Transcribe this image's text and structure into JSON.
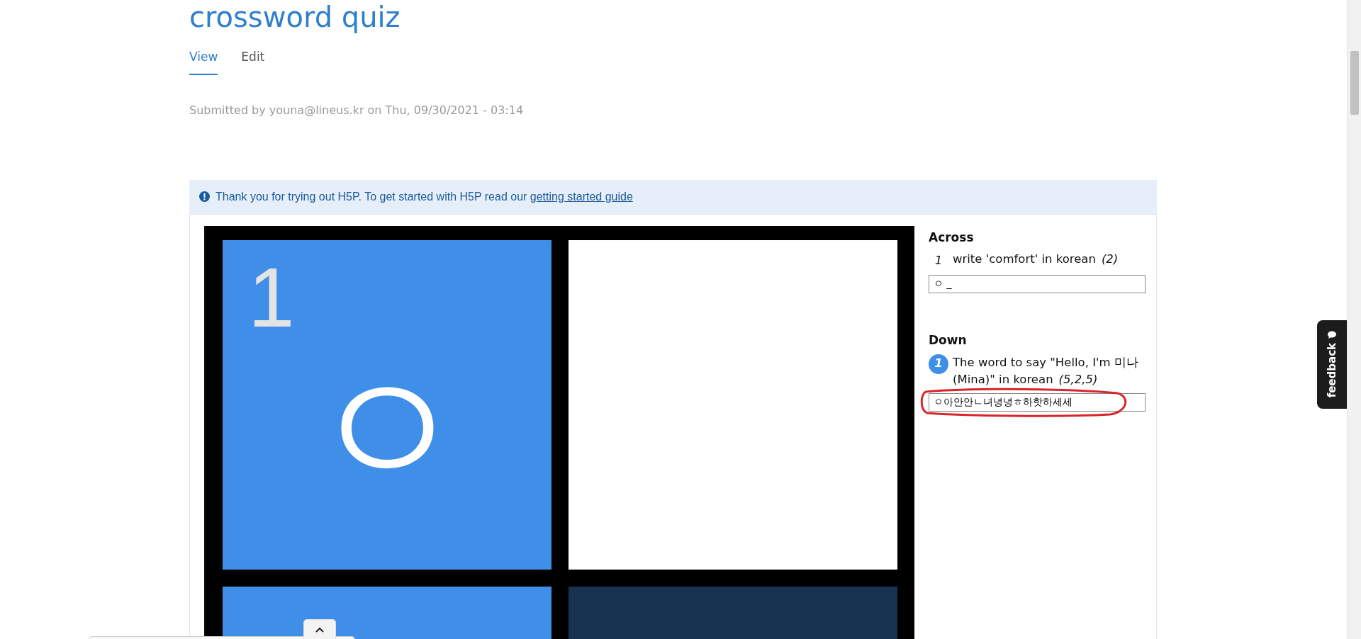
{
  "page_title": "crossword quiz",
  "tabs": [
    {
      "label": "View",
      "selected": true
    },
    {
      "label": "Edit",
      "selected": false
    }
  ],
  "submitted": "Submitted by youna@lineus.kr on Thu, 09/30/2021 - 03:14",
  "notice": {
    "text": "Thank you for trying out H5P. To get started with H5P read our",
    "link": "getting started guide"
  },
  "grid": [
    [
      {
        "kind": "highlighted",
        "number": "1",
        "letter": "ㅇ"
      },
      {
        "kind": "plain"
      }
    ],
    [
      {
        "kind": "highlighted"
      },
      {
        "kind": "focused"
      }
    ]
  ],
  "clue_groups": [
    {
      "heading": "Across",
      "clues": [
        {
          "number": "1",
          "text": "write 'comfort' in korean",
          "length": "(2)",
          "selected": false,
          "answer": "ㅇ _"
        }
      ]
    },
    {
      "heading": "Down",
      "clues": [
        {
          "number": "1",
          "text": "The word to say \"Hello, I'm 미나(Mina)\" in korean",
          "length": "(5,2,5)",
          "selected": true,
          "answer": "ㅇ아안안ㄴ녀녕녕ㅎ하핫하세세"
        }
      ]
    }
  ],
  "feedback_tab": "feedback"
}
